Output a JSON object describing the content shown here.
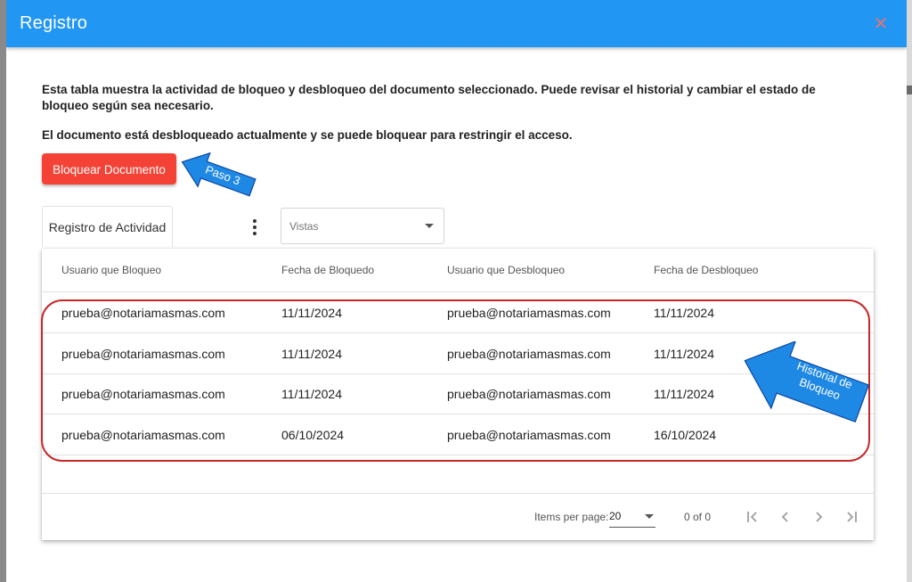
{
  "dialog": {
    "title": "Registro",
    "close_icon": "close-icon"
  },
  "content": {
    "description": "Esta tabla muestra la actividad de bloqueo y desbloqueo del documento seleccionado. Puede revisar el historial y cambiar el estado de bloqueo según sea necesario.",
    "status": "El documento está desbloqueado actualmente y se puede bloquear para restringir el acceso.",
    "lock_button_label": "Bloquear Documento",
    "activity_tab_label": "Registro de Actividad",
    "more_icon": "more-vertical-icon",
    "views_placeholder": "Vistas"
  },
  "table": {
    "columns": [
      "Usuario que Bloqueo",
      "Fecha de Bloquedo",
      "Usuario que Desbloqueo",
      "Fecha de Desbloqueo"
    ],
    "rows": [
      [
        "prueba@notariamasmas.com",
        "11/11/2024",
        "prueba@notariamasmas.com",
        "11/11/2024"
      ],
      [
        "prueba@notariamasmas.com",
        "11/11/2024",
        "prueba@notariamasmas.com",
        "11/11/2024"
      ],
      [
        "prueba@notariamasmas.com",
        "11/11/2024",
        "prueba@notariamasmas.com",
        "11/11/2024"
      ],
      [
        "prueba@notariamasmas.com",
        "06/10/2024",
        "prueba@notariamasmas.com",
        "16/10/2024"
      ]
    ]
  },
  "paginator": {
    "items_per_page_label": "Items per page:",
    "items_per_page_value": "20",
    "range_label": "0 of 0",
    "icons": [
      "first-page-icon",
      "previous-page-icon",
      "next-page-icon",
      "last-page-icon"
    ]
  },
  "annotations": {
    "step_label": "Paso 3",
    "history_label_line1": "Historial de",
    "history_label_line2": "Bloqueo"
  },
  "colors": {
    "header": "#2196f3",
    "lock_button": "#f44336",
    "annotation_arrow": "#1e88e5",
    "highlight_border": "#c62828"
  }
}
